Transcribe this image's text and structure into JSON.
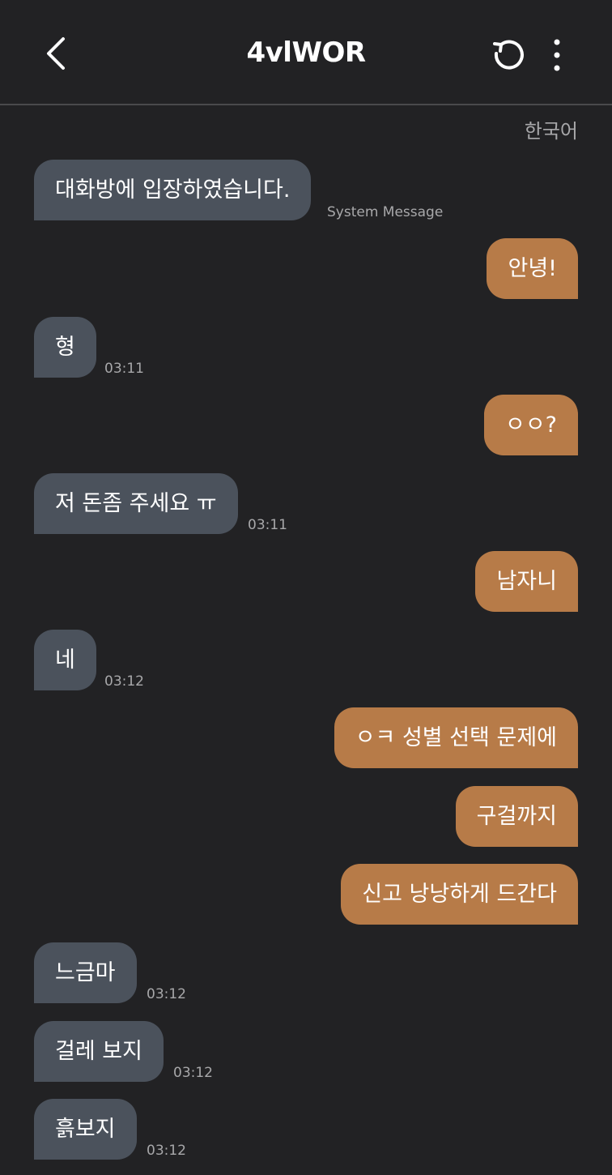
{
  "header": {
    "title": "4vlWOR",
    "back_icon": "chevron-left-icon",
    "refresh_icon": "refresh-icon",
    "more_icon": "more-vertical-icon"
  },
  "language": "한국어",
  "messages": [
    {
      "side": "in",
      "text": "대화방에 입장하였습니다.",
      "meta": "System Message"
    },
    {
      "side": "out",
      "text": "안녕!"
    },
    {
      "side": "in",
      "text": "형",
      "meta": "03:11"
    },
    {
      "side": "out",
      "text": "ㅇㅇ?"
    },
    {
      "side": "in",
      "text": "저 돈좀 주세요 ㅠ",
      "meta": "03:11"
    },
    {
      "side": "out",
      "text": "남자니"
    },
    {
      "side": "in",
      "text": "네",
      "meta": "03:12"
    },
    {
      "side": "out",
      "text": "ㅇㅋ 성별 선택 문제에"
    },
    {
      "side": "out",
      "text": "구걸까지"
    },
    {
      "side": "out",
      "text": "신고 낭낭하게 드간다"
    },
    {
      "side": "in",
      "text": "느금마",
      "meta": "03:12"
    },
    {
      "side": "in",
      "text": "걸레 보지",
      "meta": "03:12"
    },
    {
      "side": "in",
      "text": "흙보지",
      "meta": "03:12"
    }
  ],
  "colors": {
    "background": "#222224",
    "incoming_bubble": "#4b525c",
    "outgoing_bubble": "#b77b48",
    "meta_text": "#a8a8aa"
  }
}
